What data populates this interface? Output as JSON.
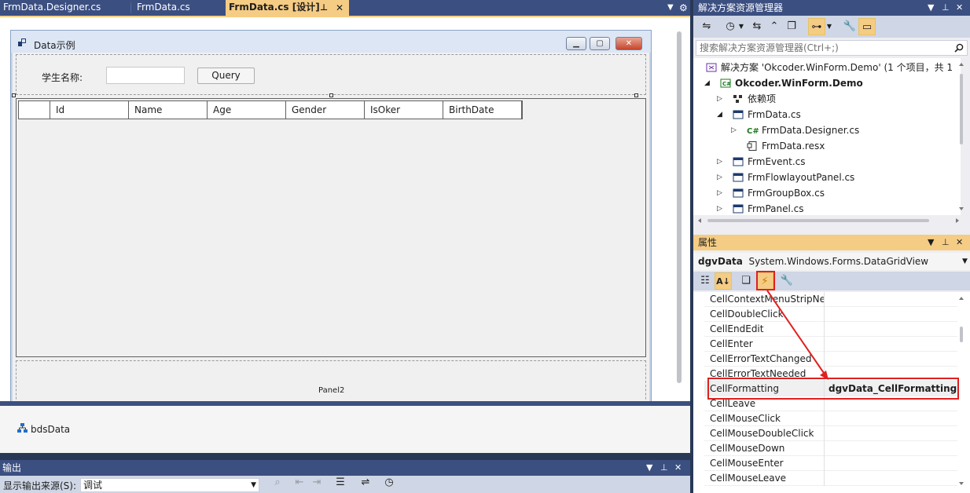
{
  "editor_tabs": [
    {
      "label": "FrmData.Designer.cs"
    },
    {
      "label": "FrmData.cs"
    },
    {
      "label": "FrmData.cs [设计]",
      "active": true
    }
  ],
  "form": {
    "title": "Data示例",
    "student_name_label": "学生名称:",
    "query_button": "Query",
    "name_input_value": "",
    "grid_columns": [
      "",
      "Id",
      "Name",
      "Age",
      "Gender",
      "IsOker",
      "BirthDate"
    ],
    "panel2_label": "Panel2"
  },
  "component_tray": {
    "items": [
      "bdsData"
    ]
  },
  "output": {
    "title": "输出",
    "source_label": "显示输出来源(S):",
    "source_value": "调试"
  },
  "solution_explorer": {
    "title": "解决方案资源管理器",
    "search_placeholder": "搜索解决方案资源管理器(Ctrl+;)",
    "items": [
      {
        "label": "解决方案 'Okcoder.WinForm.Demo' (1 个项目，共 1"
      },
      {
        "label": "Okcoder.WinForm.Demo",
        "bold": true
      },
      {
        "label": "依赖项"
      },
      {
        "label": "FrmData.cs"
      },
      {
        "label": "FrmData.Designer.cs"
      },
      {
        "label": "FrmData.resx"
      },
      {
        "label": "FrmEvent.cs"
      },
      {
        "label": "FrmFlowlayoutPanel.cs"
      },
      {
        "label": "FrmGroupBox.cs"
      },
      {
        "label": "FrmPanel.cs"
      }
    ]
  },
  "properties": {
    "title": "属性",
    "object_name": "dgvData",
    "object_type": "System.Windows.Forms.DataGridView",
    "events": [
      {
        "name": "CellContextMenuStripNee",
        "value": ""
      },
      {
        "name": "CellDoubleClick",
        "value": ""
      },
      {
        "name": "CellEndEdit",
        "value": ""
      },
      {
        "name": "CellEnter",
        "value": ""
      },
      {
        "name": "CellErrorTextChanged",
        "value": ""
      },
      {
        "name": "CellErrorTextNeeded",
        "value": ""
      },
      {
        "name": "CellFormatting",
        "value": "dgvData_CellFormatting"
      },
      {
        "name": "CellLeave",
        "value": ""
      },
      {
        "name": "CellMouseClick",
        "value": ""
      },
      {
        "name": "CellMouseDoubleClick",
        "value": ""
      },
      {
        "name": "CellMouseDown",
        "value": ""
      },
      {
        "name": "CellMouseEnter",
        "value": ""
      },
      {
        "name": "CellMouseLeave",
        "value": ""
      }
    ]
  },
  "colors": {
    "accent": "#f5cc84",
    "chrome": "#3b4f81",
    "annotation": "#e02020"
  }
}
